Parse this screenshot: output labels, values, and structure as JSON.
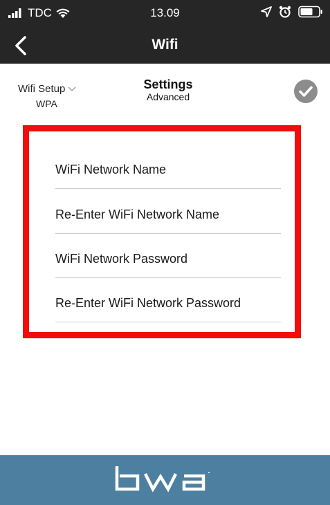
{
  "status_bar": {
    "carrier": "TDC",
    "time": "13.09",
    "icons": [
      "signal-icon",
      "wifi-icon",
      "location-icon",
      "alarm-icon",
      "battery-icon"
    ]
  },
  "nav": {
    "title": "Wifi",
    "back_icon": "chevron-left-icon"
  },
  "toolbar": {
    "setup_label": "Wifi Setup",
    "setup_value": "WPA",
    "settings_title": "Settings",
    "settings_subtitle": "Advanced",
    "confirm_icon": "checkmark-icon"
  },
  "form": {
    "fields": [
      {
        "placeholder": "WiFi Network Name"
      },
      {
        "placeholder": "Re-Enter WiFi Network Name"
      },
      {
        "placeholder": "WiFi Network Password"
      },
      {
        "placeholder": "Re-Enter WiFi Network Password"
      }
    ],
    "highlight_color": "#f20d0d"
  },
  "footer": {
    "brand_logo": "bwa",
    "background_color": "#4d7fa1"
  },
  "colors": {
    "bar_background": "#262626",
    "text": "#ffffff"
  }
}
